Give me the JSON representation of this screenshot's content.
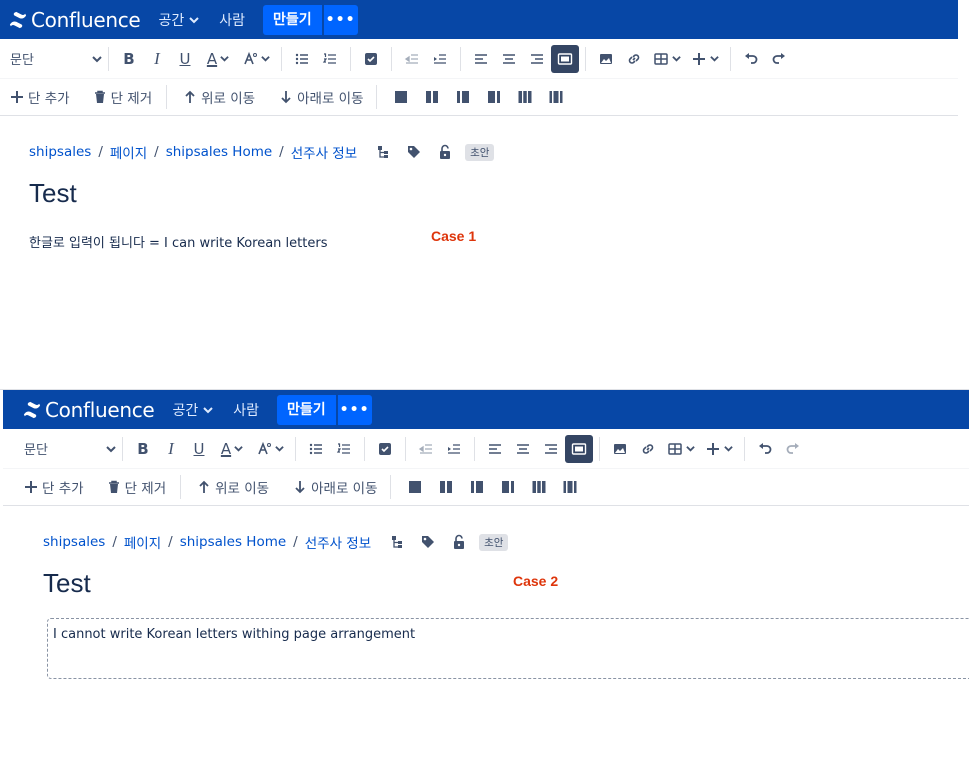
{
  "nav": {
    "logo": "Confluence",
    "spaces": "공간",
    "people": "사람",
    "create": "만들기",
    "more": "•••"
  },
  "toolbar": {
    "paragraph": "문단",
    "bold": "B",
    "italic": "I",
    "underline": "U",
    "text_color": "A",
    "add_column": "단 추가",
    "remove_column": "단 제거",
    "move_up": "위로 이동",
    "move_down": "아래로 이동"
  },
  "breadcrumb": {
    "space": "shipsales",
    "pages": "페이지",
    "home": "shipsales Home",
    "parent": "선주사 정보",
    "status": "초안"
  },
  "case1": {
    "title": "Test",
    "body": "한글로 입력이 됩니다 = I can write Korean letters",
    "label": "Case 1"
  },
  "case2": {
    "title": "Test",
    "body": "I cannot write Korean letters withing page arrangement",
    "label": "Case 2"
  },
  "colors": {
    "nav_bg": "#0747a6",
    "create_bg": "#0065ff",
    "link": "#0052cc",
    "case_label": "#de350b",
    "active_tool": "#344563"
  }
}
